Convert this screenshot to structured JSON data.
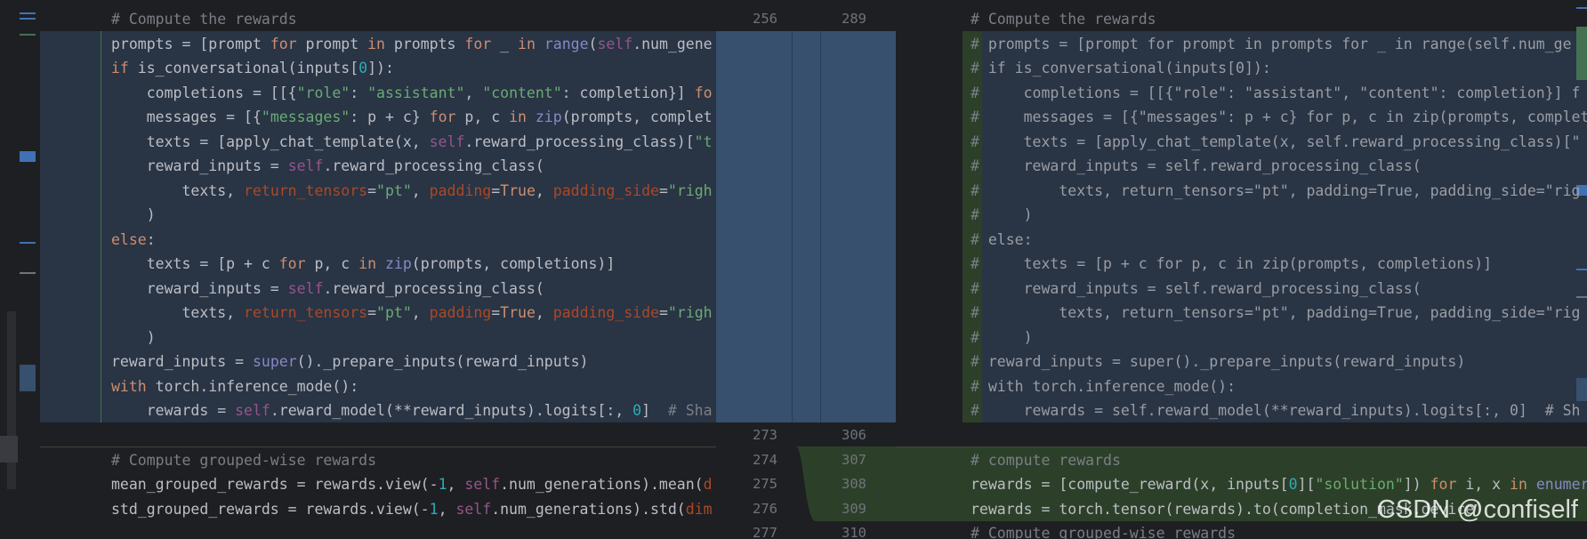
{
  "left": {
    "top_comment": "# Compute the rewards",
    "changed_lines": [
      "prompts = [prompt for prompt in prompts for _ in range(self.num_gene",
      "if is_conversational(inputs[0]):",
      "    completions = [[{\"role\": \"assistant\", \"content\": completion}] fo",
      "    messages = [{\"messages\": p + c} for p, c in zip(prompts, complet",
      "    texts = [apply_chat_template(x, self.reward_processing_class)[\"t",
      "    reward_inputs = self.reward_processing_class(",
      "        texts, return_tensors=\"pt\", padding=True, padding_side=\"righ",
      "    )",
      "else:",
      "    texts = [p + c for p, c in zip(prompts, completions)]",
      "    reward_inputs = self.reward_processing_class(",
      "        texts, return_tensors=\"pt\", padding=True, padding_side=\"righ",
      "    )",
      "reward_inputs = super()._prepare_inputs(reward_inputs)",
      "with torch.inference_mode():",
      "    rewards = self.reward_model(**reward_inputs).logits[:, 0]  # Sha"
    ],
    "after_lines": [
      "# Compute grouped-wise rewards",
      "mean_grouped_rewards = rewards.view(-1, self.num_generations).mean(d",
      "std_grouped_rewards = rewards.view(-1, self.num_generations).std(dim"
    ]
  },
  "gutter": {
    "top_left": "256",
    "top_right": "289",
    "left_nums": [
      "273",
      "274",
      "275",
      "276",
      "277"
    ],
    "right_nums": [
      "306",
      "307",
      "308",
      "309",
      "310"
    ]
  },
  "right": {
    "top_comment": "# Compute the rewards",
    "commented_lines": [
      "prompts = [prompt for prompt in prompts for _ in range(self.num_ge",
      "if is_conversational(inputs[0]):",
      "    completions = [[{\"role\": \"assistant\", \"content\": completion}] f",
      "    messages = [{\"messages\": p + c} for p, c in zip(prompts, complet",
      "    texts = [apply_chat_template(x, self.reward_processing_class)[\"",
      "    reward_inputs = self.reward_processing_class(",
      "        texts, return_tensors=\"pt\", padding=True, padding_side=\"rig",
      "    )",
      "else:",
      "    texts = [p + c for p, c in zip(prompts, completions)]",
      "    reward_inputs = self.reward_processing_class(",
      "        texts, return_tensors=\"pt\", padding=True, padding_side=\"rig",
      "    )",
      "reward_inputs = super()._prepare_inputs(reward_inputs)",
      "with torch.inference_mode():",
      "    rewards = self.reward_model(**reward_inputs).logits[:, 0]  # Sh"
    ],
    "added_lines": [
      "# compute rewards",
      "rewards = [compute_reward(x, inputs[0][\"solution\"]) for i, x in enumer",
      "rewards = torch.tensor(rewards).to(completion_mask.device)"
    ],
    "last_line": "# Compute grouped-wise rewards"
  },
  "watermark": "CSDN @confiself",
  "colors": {
    "background": "#1e1f22",
    "modified_bg": "#293445",
    "gutter_modified": "#36506d",
    "added_bg": "#2c4029",
    "stripe_green": "#447152",
    "keyword": "#cf8e6d",
    "string": "#6aab73",
    "number": "#2aacb8",
    "builtin": "#8888c6",
    "self": "#94558d",
    "param": "#aa4926",
    "comment": "#7a7e85"
  }
}
